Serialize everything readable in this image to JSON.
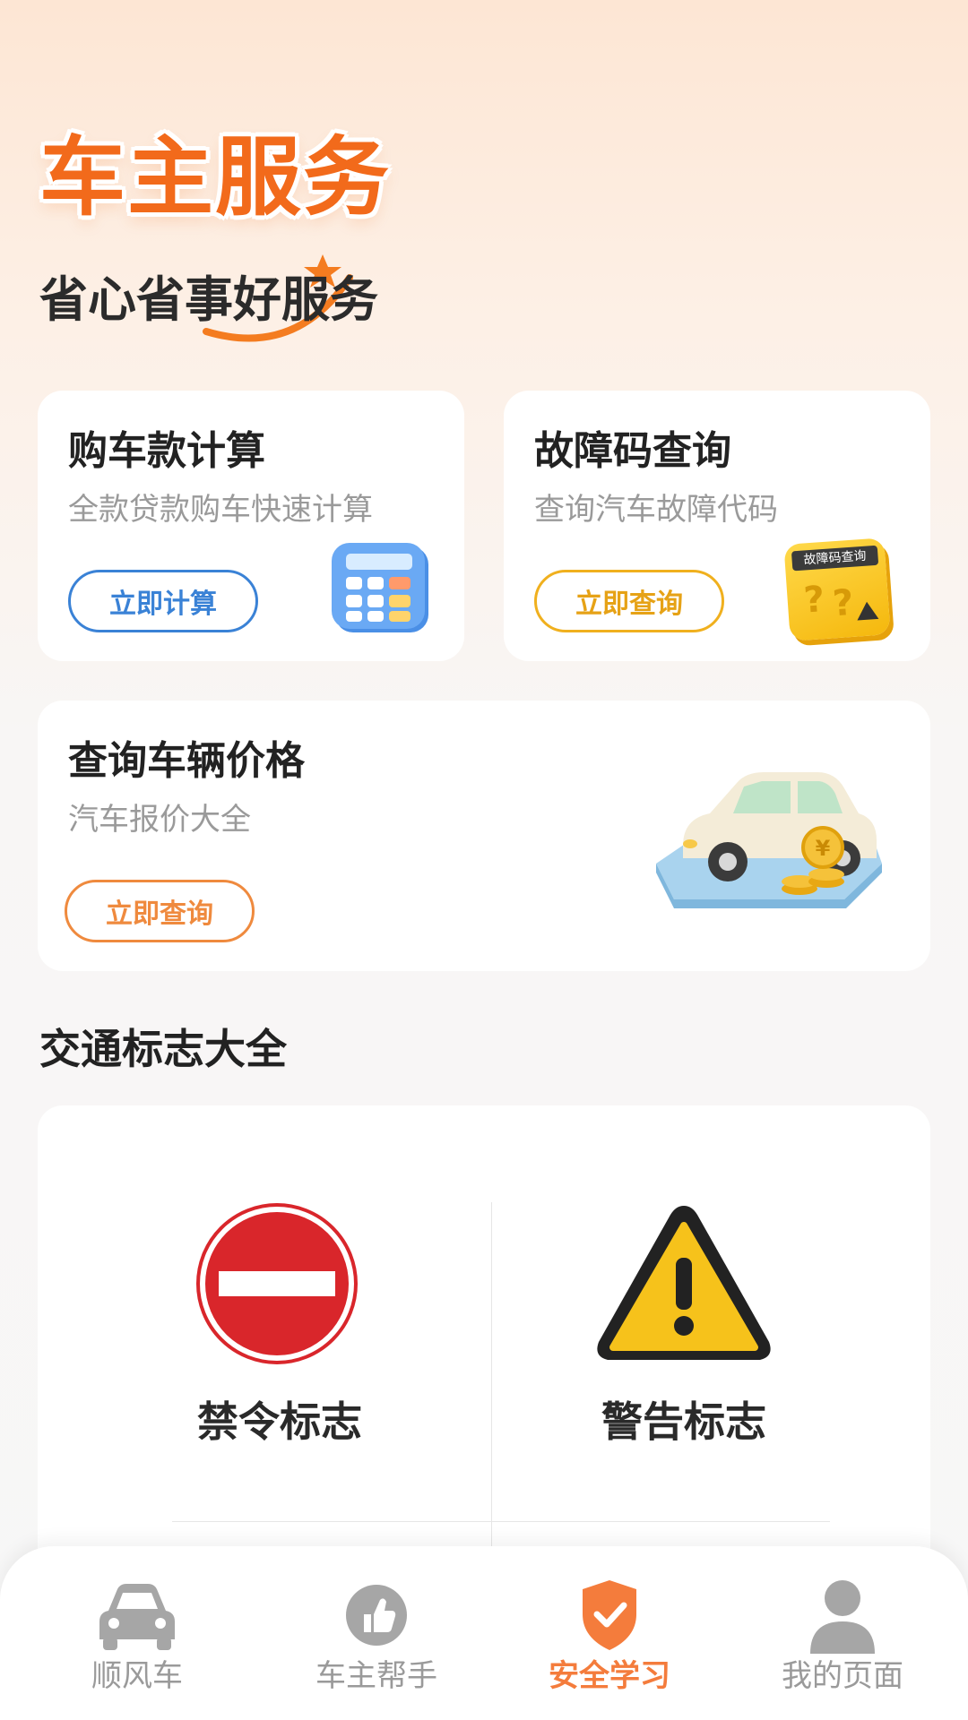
{
  "hero": {
    "title": "车主服务",
    "subtitle": "省心省事好服务"
  },
  "cards": {
    "loan": {
      "title": "购车款计算",
      "desc": "全款贷款购车快速计算",
      "button": "立即计算",
      "accent": "#3a82d6"
    },
    "fault": {
      "title": "故障码查询",
      "desc": "查询汽车故障代码",
      "button": "立即查询",
      "accent": "#f0b01e",
      "image_text": "故障码查询"
    },
    "price": {
      "title": "查询车辆价格",
      "desc": "汽车报价大全",
      "button": "立即查询",
      "accent": "#ef8a3e"
    }
  },
  "signs": {
    "title": "交通标志大全",
    "items": [
      {
        "label": "禁令标志",
        "icon": "no-entry-sign-icon",
        "color": "#d9262b"
      },
      {
        "label": "警告标志",
        "icon": "warning-sign-icon",
        "color": "#f6c21b"
      }
    ]
  },
  "tabbar": {
    "active_color": "#f47c3c",
    "items": [
      {
        "label": "顺风车",
        "icon": "car-icon"
      },
      {
        "label": "车主帮手",
        "icon": "thumbs-up-icon"
      },
      {
        "label": "安全学习",
        "icon": "shield-check-icon",
        "active": true
      },
      {
        "label": "我的页面",
        "icon": "user-icon"
      }
    ]
  }
}
